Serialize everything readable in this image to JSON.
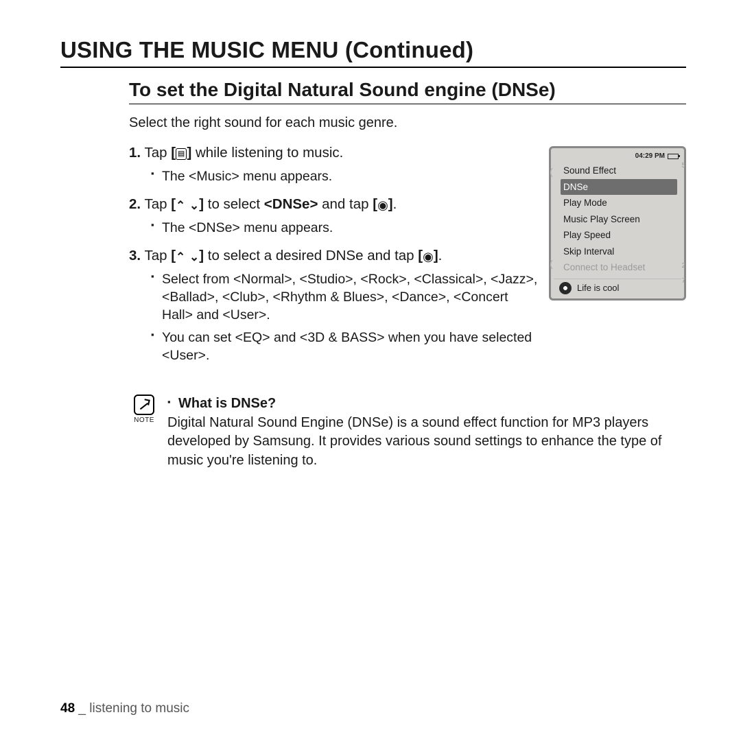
{
  "page_title": "USING THE MUSIC MENU (Continued)",
  "section_title": "To set the Digital Natural Sound engine (DNSe)",
  "intro": "Select the right sound for each music genre.",
  "steps": {
    "s1_num": "1.",
    "s1_a": "Tap ",
    "s1_b": " while listening to music.",
    "s1_sub1": "The <Music> menu appears.",
    "s2_num": "2.",
    "s2_a": "Tap ",
    "s2_b": " to select ",
    "s2_bold": "<DNSe>",
    "s2_c": " and tap ",
    "s2_d": ".",
    "s2_sub1": "The <DNSe> menu appears.",
    "s3_num": "3.",
    "s3_a": "Tap ",
    "s3_b": " to select a desired DNSe and tap ",
    "s3_c": ".",
    "s3_sub1": "Select from <Normal>, <Studio>, <Rock>, <Classical>, <Jazz>, <Ballad>, <Club>, <Rhythm & Blues>, <Dance>, <Concert Hall>  and <User>.",
    "s3_sub2": "You can set <EQ> and <3D & BASS> when you have selected <User>."
  },
  "note": {
    "label": "NOTE",
    "heading": "What is DNSe?",
    "body": "Digital Natural Sound Engine (DNSe) is a sound effect function for MP3 players developed by Samsung. It provides various sound settings to enhance the type of music you're listening to."
  },
  "device": {
    "time": "04:29 PM",
    "menu": {
      "m0": "Sound Effect",
      "m1": "DNSe",
      "m2": "Play Mode",
      "m3": "Music Play Screen",
      "m4": "Play Speed",
      "m5": "Skip Interval",
      "m6": "Connect to Headset"
    },
    "now_playing": "Life is cool",
    "side_5": "5",
    "side_2": "2",
    "side_7": "7"
  },
  "footer": {
    "page": "48",
    "sep": " _ ",
    "section": "listening to music"
  },
  "icons": {
    "menu_glyph": "▤",
    "updown_open": "[",
    "up": "⌃",
    "down": "⌄",
    "updown_close": "]",
    "select_open": "[",
    "select": "◉",
    "select_close": "]"
  }
}
